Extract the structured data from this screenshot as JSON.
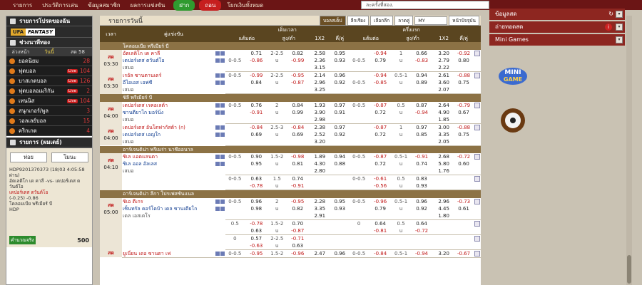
{
  "topnav": {
    "items": [
      "รายการ",
      "ประวัติการเล่น",
      "ข้อมูลสมาชิก",
      "ผลการแข่งขัน"
    ],
    "deposit": "ฝาก",
    "withdraw": "ถอน",
    "transfer": "โยกเงินทั้งหมด",
    "search_text": "ละครั้งที่สอง."
  },
  "left": {
    "fav": "รายการโปรดของฉัน",
    "fantasy": [
      "UFA",
      "FANTASY"
    ],
    "hotbet": "ช่วงนาทีทอง",
    "tabs": [
      "ล่วงหน้า",
      "วันนี้",
      "สด 58"
    ],
    "sports": [
      {
        "name": "ยอดนิยม",
        "live": false,
        "count": "28"
      },
      {
        "name": "ฟุตบอล",
        "live": true,
        "count": "104"
      },
      {
        "name": "บาสเกตบอล",
        "live": true,
        "count": "126"
      },
      {
        "name": "ฟุตบอลอเมริกัน",
        "live": true,
        "count": "2"
      },
      {
        "name": "เทนนิส",
        "live": true,
        "count": "104"
      },
      {
        "name": "สนุกเกอร์/พูล",
        "live": false,
        "count": "3"
      },
      {
        "name": "วอลเลย์บอล",
        "live": false,
        "count": "15"
      },
      {
        "name": "คริกเกต",
        "live": false,
        "count": "4"
      }
    ],
    "betslip": {
      "header": "รายการ (ผมเดย์)",
      "btn1": "ท่อย",
      "btn2": "โมนะ",
      "line1": "HDP9201370373 (18/03 4:05:58",
      "line2": "ผ่าน)",
      "line3": "อัตเลติโก เด คาลี -vs- เดปอร์เตส ต",
      "line4": "วันต์โอ",
      "pick": "เดปอร์เตส ตวันต์โอ",
      "odds": "(-0.25) -0.86",
      "league": "โคลอมเบีย พรีเมียร์ บี",
      "type": "HDP",
      "calc": "คำนวณจริง",
      "amount": "500"
    }
  },
  "main": {
    "title": "รายการวันนี้",
    "filters": [
      "บอลสเต็ป",
      "ลีกเรียง",
      "เลือกลีก",
      "ลาดคู่",
      "MY",
      "หน้าปัจจุบัน"
    ],
    "head": {
      "time": "เวลา",
      "match": "คู่แข่งขัน",
      "ft": "เต็มเวลา",
      "ht": "ครึ่งแรก",
      "hdp": "แต้มต่อ",
      "ou": "สูง/ต่ำ",
      "x12": "1X2",
      "oe": "คี่/คู่"
    },
    "leagues": [
      {
        "name": "โคลอมเบีย พรีเมียร์ บี",
        "matches": [
          {
            "time": [
              "สด",
              "03:30"
            ],
            "teams": [
              "อัตเลติโก เด คาลี",
              "เดปอร์เตส ตวันต์โอ",
              "เสมอ"
            ],
            "lines": [
              [
                "",
                "0.71",
                "2-2.5",
                "0.82",
                "2.58",
                "0.95",
                "",
                "-0.94",
                "1",
                "0.66",
                "3.20",
                "-0.92"
              ],
              [
                "0-0.5",
                "-0.86",
                "u",
                "-0.99",
                "2.36",
                "0.93",
                "0-0.5",
                "0.79",
                "u",
                "-0.83",
                "2.79",
                "0.80"
              ],
              [
                "",
                "",
                "",
                "",
                "3.15",
                "",
                "",
                "",
                "",
                "",
                "2.22",
                ""
              ]
            ]
          },
          {
            "time": [
              "สด",
              "03:30"
            ],
            "teams": [
              "เรอัล ซานตานเดร์",
              "อีไอเอส เอฟซี",
              "เสมอ"
            ],
            "lines": [
              [
                "0-0.5",
                "-0.99",
                "2-2.5",
                "-0.95",
                "2.14",
                "0.96",
                "",
                "-0.94",
                "0.5-1",
                "0.94",
                "2.61",
                "-0.88"
              ],
              [
                "",
                "0.84",
                "u",
                "-0.87",
                "2.96",
                "0.92",
                "0-0.5",
                "-0.85",
                "u",
                "0.89",
                "3.60",
                "0.75"
              ],
              [
                "",
                "",
                "",
                "",
                "3.25",
                "",
                "",
                "",
                "",
                "",
                "2.07",
                ""
              ]
            ]
          }
        ]
      },
      {
        "name": "ชิลี พรีเมียร์ บี",
        "matches": [
          {
            "time": [
              "สด",
              "04:00"
            ],
            "teams": [
              "เดปอร์เตส เรคอเลต้า",
              "ซานตียาโก มอร์นิ่ง",
              "เสมอ"
            ],
            "lines": [
              [
                "0-0.5",
                "0.76",
                "2",
                "0.84",
                "1.93",
                "0.97",
                "0-0.5",
                "-0.87",
                "0.5",
                "0.87",
                "2.64",
                "-0.79"
              ],
              [
                "",
                "-0.91",
                "u",
                "0.99",
                "3.90",
                "0.91",
                "",
                "0.72",
                "u",
                "-0.94",
                "4.90",
                "0.67"
              ],
              [
                "",
                "",
                "",
                "",
                "2.98",
                "",
                "",
                "",
                "",
                "",
                "1.85",
                ""
              ]
            ]
          },
          {
            "time": [
              "สด",
              "04:00"
            ],
            "teams": [
              "เดปอร์เตส อันโตฟากัสต้า (ก)",
              "เดปอร์เตส เอญใก",
              "เสมอ"
            ],
            "lines": [
              [
                "",
                "-0.84",
                "2.5-3",
                "-0.84",
                "2.38",
                "0.97",
                "",
                "-0.87",
                "1",
                "0.97",
                "3.00",
                "-0.88"
              ],
              [
                "",
                "0.69",
                "u",
                "0.69",
                "2.52",
                "0.92",
                "",
                "0.72",
                "u",
                "0.85",
                "3.35",
                "0.75"
              ],
              [
                "",
                "",
                "",
                "",
                "3.20",
                "",
                "",
                "",
                "",
                "",
                "2.05",
                ""
              ]
            ]
          }
        ]
      },
      {
        "name": "อาร์เจนติน่า พรีเมร่า นาซีออนาล",
        "matches": [
          {
            "time": [
              "สด",
              "04:10"
            ],
            "teams": [
              "ชิเล แอตแลนตา",
              "ชิเล ออล อัลเลส",
              "เสมอ"
            ],
            "lines": [
              [
                "0-0.5",
                "0.90",
                "1.5-2",
                "-0.98",
                "1.89",
                "0.94",
                "0-0.5",
                "-0.87",
                "0.5-1",
                "-0.91",
                "2.68",
                "-0.72"
              ],
              [
                "",
                "0.95",
                "u",
                "0.81",
                "4.30",
                "0.88",
                "",
                "0.72",
                "u",
                "0.74",
                "5.80",
                "0.60"
              ],
              [
                "",
                "",
                "",
                "",
                "2.80",
                "",
                "",
                "",
                "",
                "",
                "1.76",
                ""
              ]
            ]
          },
          {
            "time": [
              "",
              ""
            ],
            "teams": [
              "",
              "",
              ""
            ],
            "lines": [
              [
                "0-0.5",
                "0.63",
                "1.5",
                "0.74",
                "",
                "",
                "0-0.5",
                "-0.61",
                "0.5",
                "0.83",
                "",
                ""
              ],
              [
                "",
                "-0.78",
                "u",
                "-0.91",
                "",
                "",
                "",
                "-0.56",
                "u",
                "0.93",
                "",
                ""
              ]
            ]
          }
        ]
      },
      {
        "name": "อาร์เจนติน่า ลีกา โปรเฟสชันแนล",
        "matches": [
          {
            "time": [
              "สด",
              "05:00"
            ],
            "teams": [
              "ชิเอ ตีเกร",
              "เซ็นทรัล คอร์โดบ้า เดล ซานเตียโก",
              "เดล เอสเตโร",
              "เสมอ"
            ],
            "lines": [
              [
                "0-0.5",
                "0.96",
                "2",
                "-0.95",
                "2.28",
                "0.95",
                "0-0.5",
                "-0.96",
                "0.5-1",
                "0.96",
                "2.96",
                "-0.73"
              ],
              [
                "",
                "0.98",
                "u",
                "0.82",
                "3.35",
                "0.93",
                "",
                "0.79",
                "u",
                "0.92",
                "4.45",
                "0.61"
              ],
              [
                "",
                "",
                "",
                "",
                "2.91",
                "",
                "",
                "",
                "",
                "",
                "1.80",
                ""
              ]
            ]
          },
          {
            "time": [
              "",
              ""
            ],
            "teams": [
              "",
              "",
              ""
            ],
            "lines": [
              [
                "0.5",
                "-0.78",
                "1.5-2",
                "0.70",
                "",
                "",
                "0",
                "0.64",
                "0.5",
                "0.64",
                "",
                ""
              ],
              [
                "",
                "0.63",
                "u",
                "-0.87",
                "",
                "",
                "",
                "-0.81",
                "u",
                "-0.72",
                "",
                ""
              ]
            ]
          },
          {
            "time": [
              "",
              ""
            ],
            "teams": [
              "",
              "",
              ""
            ],
            "lines": [
              [
                "0",
                "0.57",
                "2-2.5",
                "-0.71",
                "",
                "",
                "",
                "",
                "",
                "",
                "",
                ""
              ],
              [
                "",
                "-0.63",
                "u",
                "0.63",
                "",
                "",
                "",
                "",
                "",
                "",
                "",
                ""
              ]
            ]
          },
          {
            "time": [
              "สด",
              ""
            ],
            "teams": [
              "ยูเนี่ยน เดอ ซานตา เฟ",
              "",
              ""
            ],
            "lines": [
              [
                "0-0.5",
                "-0.95",
                "1.5-2",
                "-0.96",
                "2.47",
                "0.96",
                "0-0.5",
                "-0.84",
                "0.5-1",
                "-0.94",
                "3.20",
                "-0.67"
              ]
            ]
          }
        ]
      }
    ]
  },
  "right": {
    "bars": [
      "ข้อมูลสด",
      "ถ่ายทอดสด",
      "Mini Games"
    ],
    "minigame_label": [
      "MINI",
      "GAME"
    ]
  },
  "colors": {
    "header": "#5a4520",
    "league": "#8c7245",
    "topbar": "#6b1515",
    "red": "#c01717",
    "blue": "#123e91"
  }
}
